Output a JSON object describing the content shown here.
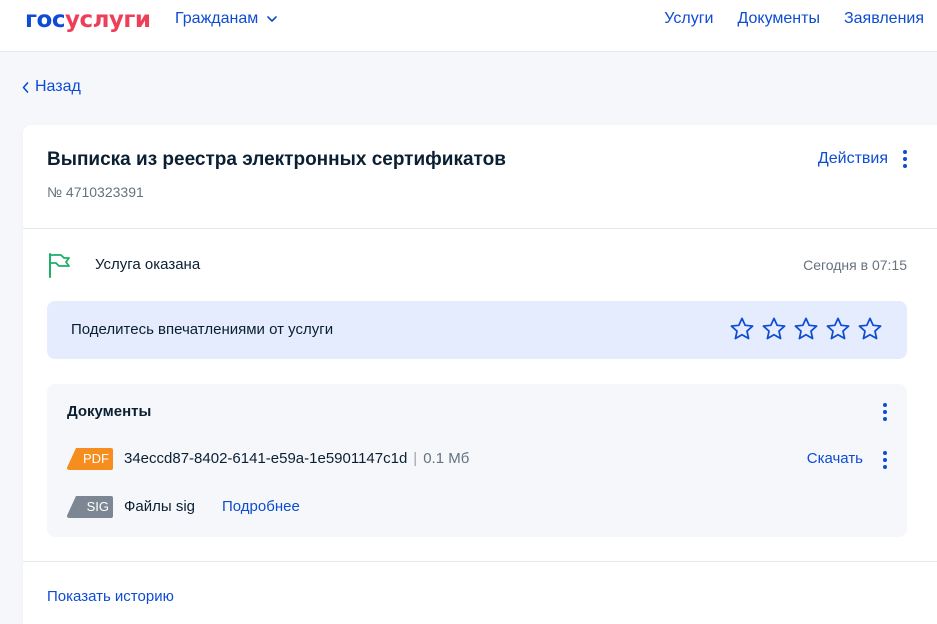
{
  "header": {
    "logo_part1": "гос",
    "logo_part2": "услуги",
    "citizens_label": "Гражданам",
    "nav": [
      "Услуги",
      "Документы",
      "Заявления"
    ]
  },
  "back_label": "Назад",
  "card": {
    "title": "Выписка из реестра электронных сертификатов",
    "number": "№ 4710323391",
    "actions_label": "Действия",
    "status": {
      "text": "Услуга оказана",
      "date": "Сегодня в 07:15",
      "icon": "flag-icon"
    },
    "feedback": {
      "text": "Поделитесь впечатлениями от услуги",
      "stars": 5
    },
    "documents": {
      "title": "Документы",
      "files": [
        {
          "badge": "PDF",
          "name": "34eccd87-8402-6141-e59a-1e5901147c1d",
          "separator": "|",
          "size": "0.1 Мб",
          "action": "Скачать"
        },
        {
          "badge": "SIG",
          "name": "Файлы sig",
          "link": "Подробнее"
        }
      ]
    },
    "history_label": "Показать историю"
  },
  "colors": {
    "brand_blue": "#0d4cd3",
    "brand_red": "#ee3f58",
    "feedback_bg": "#e4ecfd",
    "pdf_badge": "#f68e1f",
    "sig_badge": "#7d8793",
    "status_green": "#1fae6a"
  }
}
